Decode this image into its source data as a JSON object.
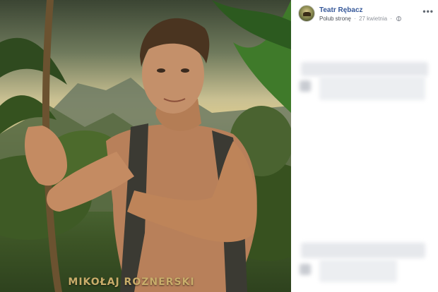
{
  "post": {
    "page_name": "Teatr Rębacz",
    "like_label": "Polub stronę",
    "separator": "·",
    "date": "27 kwietnia",
    "more_label": "•••"
  },
  "photo": {
    "caption": "MIKOŁAJ ROZNERSKI"
  },
  "colors": {
    "link": "#365899",
    "meta": "#90949c",
    "caption": "#c9ad6a"
  },
  "icons": [
    "avatar",
    "globe-icon",
    "more-options-icon"
  ]
}
